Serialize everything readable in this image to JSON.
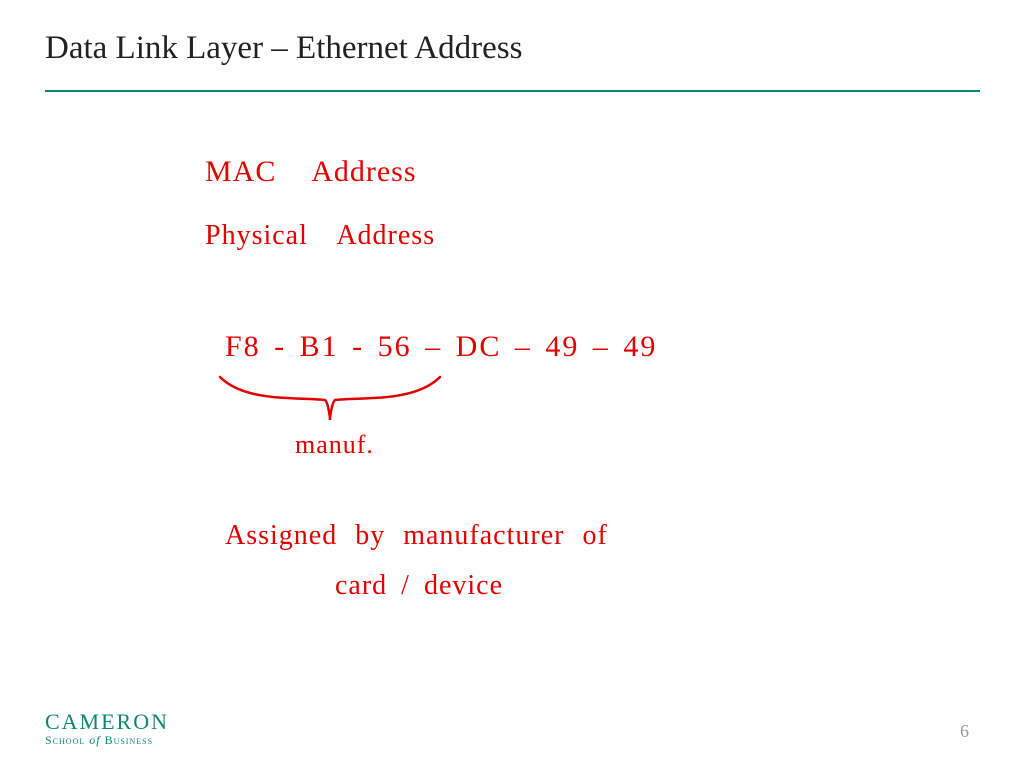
{
  "header": {
    "title": "Data Link Layer – Ethernet Address"
  },
  "annotations": {
    "line1": "MAC  Address",
    "line2": "Physical  Address",
    "mac": "F8 - B1 - 56 – DC – 49 – 49",
    "brace_label": "manuf.",
    "note_l1": "Assigned  by  manufacturer  of",
    "note_l2": "card / device"
  },
  "footer": {
    "brand_top": "CAMERON",
    "brand_bottom_1": "School",
    "brand_bottom_of": "of",
    "brand_bottom_2": "Business"
  },
  "page_number": "6",
  "colors": {
    "accent": "#0e8571",
    "ink": "#e00000"
  }
}
